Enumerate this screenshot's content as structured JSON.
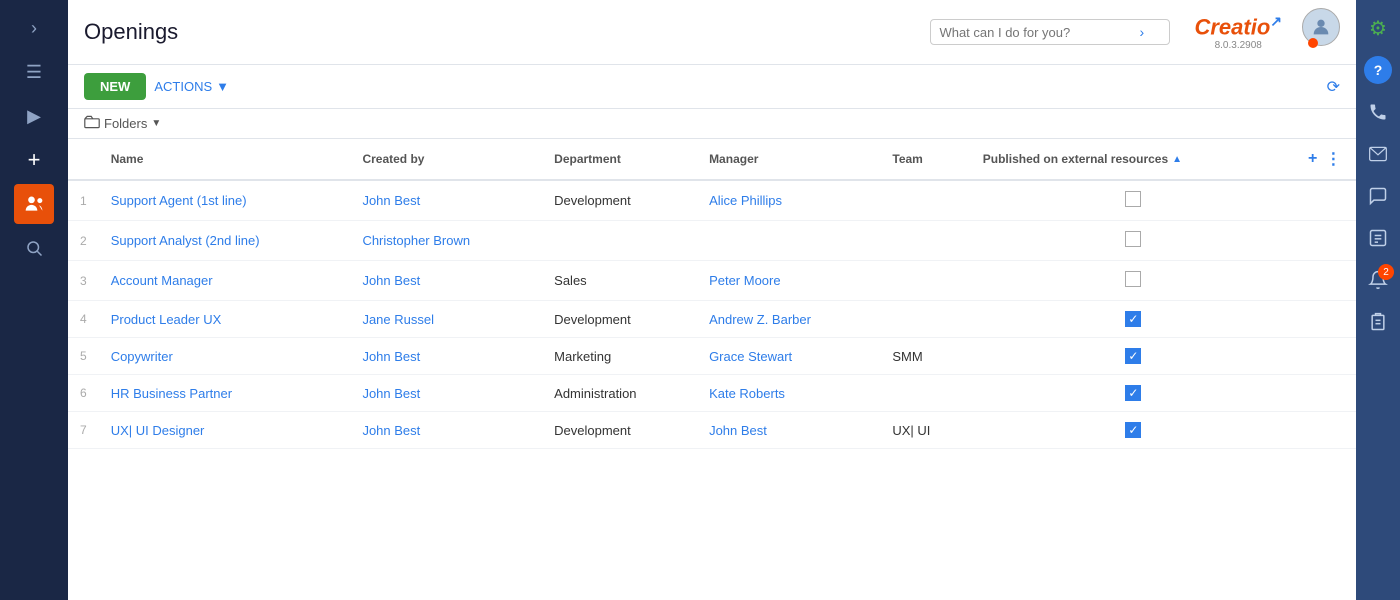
{
  "page": {
    "title": "Openings",
    "version": "8.0.3.2908"
  },
  "toolbar": {
    "new_label": "NEW",
    "actions_label": "ACTIONS",
    "folders_label": "Folders",
    "refresh_tooltip": "Refresh"
  },
  "search": {
    "placeholder": "What can I do for you?"
  },
  "logo": {
    "part1": "Creatio",
    "version": "8.0.3.2908"
  },
  "columns": [
    {
      "key": "num",
      "label": ""
    },
    {
      "key": "name",
      "label": "Name"
    },
    {
      "key": "created_by",
      "label": "Created by"
    },
    {
      "key": "department",
      "label": "Department"
    },
    {
      "key": "manager",
      "label": "Manager"
    },
    {
      "key": "team",
      "label": "Team"
    },
    {
      "key": "published",
      "label": "Published on external resources"
    }
  ],
  "rows": [
    {
      "num": 1,
      "name": "Support Agent (1st line)",
      "created_by": "John Best",
      "department": "Development",
      "manager": "Alice Phillips",
      "team": "",
      "published": false
    },
    {
      "num": 2,
      "name": "Support Analyst (2nd line)",
      "created_by": "Christopher Brown",
      "department": "",
      "manager": "",
      "team": "",
      "published": false
    },
    {
      "num": 3,
      "name": "Account Manager",
      "created_by": "John Best",
      "department": "Sales",
      "manager": "Peter Moore",
      "team": "",
      "published": false
    },
    {
      "num": 4,
      "name": "Product Leader UX",
      "created_by": "Jane Russel",
      "department": "Development",
      "manager": "Andrew Z. Barber",
      "team": "",
      "published": true
    },
    {
      "num": 5,
      "name": "Copywriter",
      "created_by": "John Best",
      "department": "Marketing",
      "manager": "Grace Stewart",
      "team": "SMM",
      "published": true
    },
    {
      "num": 6,
      "name": "HR Business Partner",
      "created_by": "John Best",
      "department": "Administration",
      "manager": "Kate Roberts",
      "team": "",
      "published": true
    },
    {
      "num": 7,
      "name": "UX| UI Designer",
      "created_by": "John Best",
      "department": "Development",
      "manager": "John Best",
      "team": "UX| UI",
      "published": true
    }
  ],
  "sidebar": {
    "icons": [
      {
        "name": "chevron-right-icon",
        "symbol": "›",
        "active": false
      },
      {
        "name": "hamburger-icon",
        "symbol": "≡",
        "active": false
      },
      {
        "name": "play-icon",
        "symbol": "▶",
        "active": false
      },
      {
        "name": "plus-icon",
        "symbol": "+",
        "active": false
      },
      {
        "name": "people-icon",
        "symbol": "👤",
        "active": true
      },
      {
        "name": "search-icon",
        "symbol": "🔍",
        "active": false
      }
    ]
  },
  "right_panel": {
    "icons": [
      {
        "name": "gear-icon",
        "symbol": "⚙",
        "badge": null,
        "color": "#4caf50"
      },
      {
        "name": "help-icon",
        "symbol": "?",
        "badge": null,
        "color": "#2e7de9"
      },
      {
        "name": "phone-icon",
        "symbol": "📞",
        "badge": null,
        "color": "#c0d0e8"
      },
      {
        "name": "email-icon",
        "symbol": "✉",
        "badge": null,
        "color": "#c0d0e8"
      },
      {
        "name": "chat-icon",
        "symbol": "💬",
        "badge": null,
        "color": "#c0d0e8"
      },
      {
        "name": "contacts-icon",
        "symbol": "📋",
        "badge": null,
        "color": "#c0d0e8"
      },
      {
        "name": "bell-icon",
        "symbol": "🔔",
        "badge": "2",
        "color": "#c0d0e8"
      },
      {
        "name": "clipboard-icon",
        "symbol": "📝",
        "badge": null,
        "color": "#c0d0e8"
      }
    ]
  }
}
